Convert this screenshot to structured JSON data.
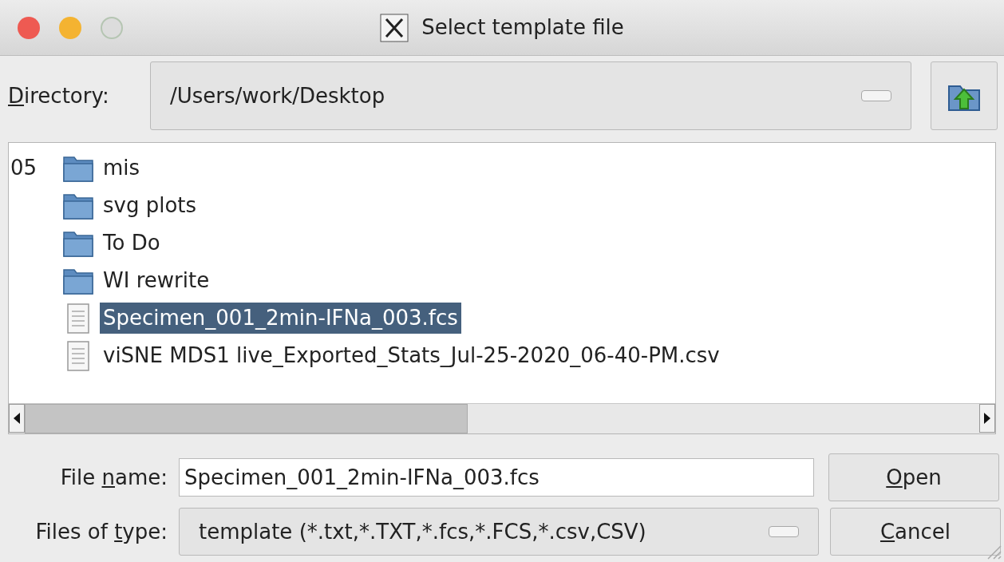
{
  "window": {
    "title": "Select template file"
  },
  "directory": {
    "label": [
      {
        "text": "D",
        "underlined": true
      },
      {
        "text": "irectory:",
        "underlined": false
      }
    ],
    "value": "/Users/work/Desktop"
  },
  "files": [
    {
      "column_1": "05",
      "name": "mis",
      "kind": "folder",
      "selected": false
    },
    {
      "name": "svg plots",
      "kind": "folder",
      "selected": false
    },
    {
      "name": "To Do",
      "kind": "folder",
      "selected": false
    },
    {
      "name": "WI rewrite",
      "kind": "folder",
      "selected": false
    },
    {
      "name": "Specimen_001_2min-IFNa_003.fcs",
      "kind": "file",
      "selected": true
    },
    {
      "name": "viSNE MDS1 live_Exported_Stats_Jul-25-2020_06-40-PM.csv",
      "kind": "file",
      "selected": false
    }
  ],
  "file_name": {
    "label": [
      {
        "text": "File ",
        "underlined": false
      },
      {
        "text": "n",
        "underlined": true
      },
      {
        "text": "ame:",
        "underlined": false
      }
    ],
    "value": "Specimen_001_2min-IFNa_003.fcs"
  },
  "file_type": {
    "label": [
      {
        "text": "Files of ",
        "underlined": false
      },
      {
        "text": "t",
        "underlined": true
      },
      {
        "text": "ype:",
        "underlined": false
      }
    ],
    "value": "template (*.txt,*.TXT,*.fcs,*.FCS,*.csv,CSV)"
  },
  "buttons": [
    {
      "label": [
        {
          "text": "O",
          "underlined": true
        },
        {
          "text": "pen",
          "underlined": false
        }
      ]
    },
    {
      "label": [
        {
          "text": "C",
          "underlined": true
        },
        {
          "text": "ancel",
          "underlined": false
        }
      ]
    }
  ]
}
